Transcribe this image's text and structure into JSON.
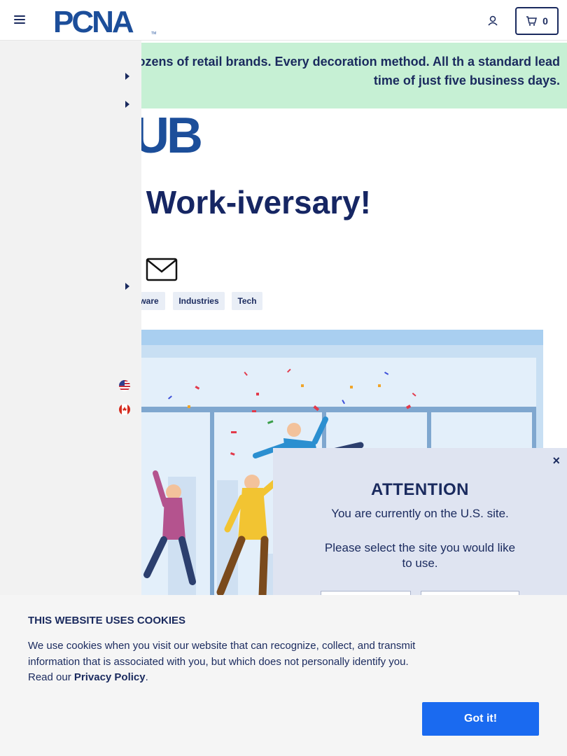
{
  "header": {
    "logo_text": "PCNA",
    "cart_count": "0"
  },
  "banner": {
    "text": "ls of products. Dozens of retail brands. Every decoration method. All th a standard lead time of just five business days."
  },
  "hub_logo_text": "UB",
  "article": {
    "title": "Work-iversary!",
    "tags": [
      {
        "label": "ware"
      },
      {
        "label": "Industries"
      },
      {
        "label": "Tech"
      }
    ]
  },
  "attention": {
    "close": "×",
    "title": "ATTENTION",
    "line1": "You are currently on the U.S. site.",
    "line2": "Please select the site you would like to use."
  },
  "cookie": {
    "title": "THIS WEBSITE USES COOKIES",
    "text": "We use cookies when you visit our website that can recognize, collect, and transmit information that is associated with you, but which does not personally identify you. Read our ",
    "link": "Privacy Policy",
    "period": ".",
    "button": "Got it!"
  },
  "colors": {
    "navy": "#1a2a5e",
    "banner_green": "#c6f0d4",
    "button_blue": "#1a6af0",
    "logo_blue": "#1c4e9a"
  }
}
